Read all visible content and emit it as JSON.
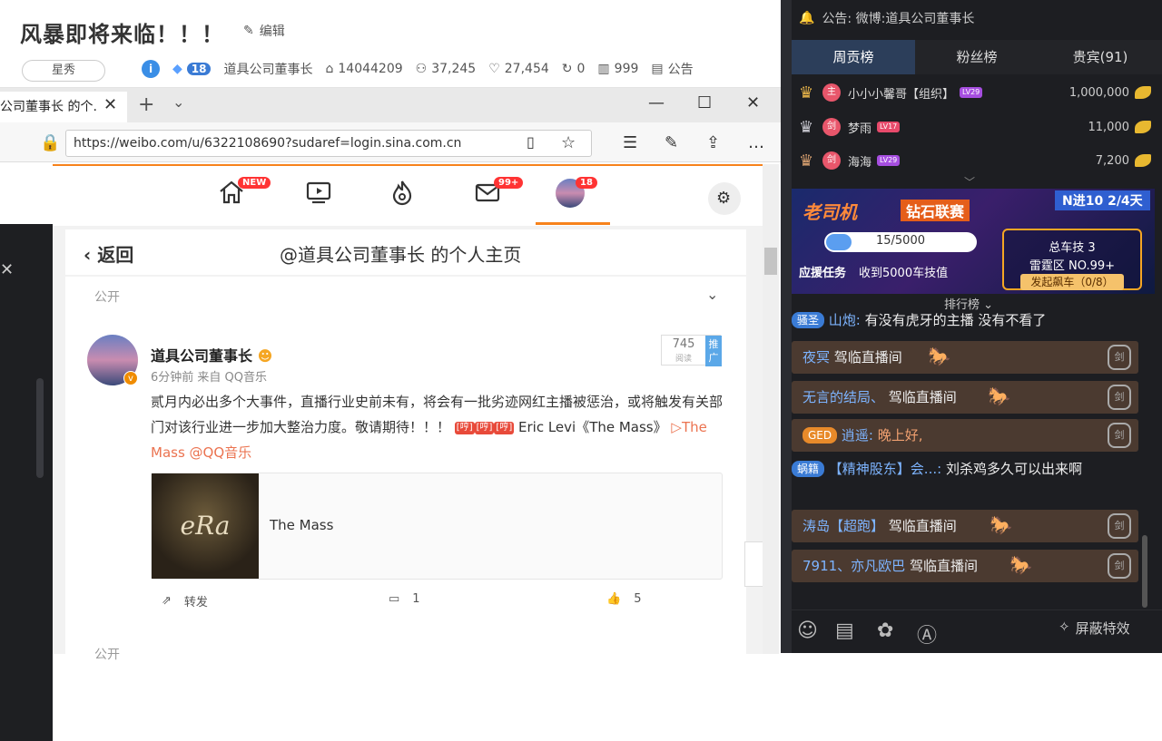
{
  "stream": {
    "title": "风暴即将来临！！！",
    "edit_label": "编辑",
    "star_tag": "星秀",
    "level": "18",
    "streamer": "道具公司董事长",
    "room_id": "14044209",
    "followers": "37,245",
    "likes": "27,454",
    "shares": "0",
    "viewers": "999",
    "notice_label": "公告"
  },
  "browser": {
    "tab_title": "公司董事长 的个.",
    "url": "https://weibo.com/u/6322108690?sudaref=login.sina.com.cn",
    "nav": {
      "home_badge": "NEW",
      "mail_badge": "99+",
      "profile_badge": "18"
    },
    "page_header": {
      "back_label": "返回",
      "title": "@道具公司董事长 的个人主页"
    },
    "feed": {
      "section_label": "公开",
      "post": {
        "author": "道具公司董事长",
        "meta": "6分钟前 来自 QQ音乐",
        "push_count": "745",
        "push_sub": "阅读",
        "push_btn": "推广",
        "text": "贰月内必出多个大事件，直播行业史前未有，将会有一批劣迹网红主播被惩治，或将触发有关部门对该行业进一步加大整治力度。敬请期待！！！",
        "emoji": "[哼]",
        "text_tail": " Eric Levi《The Mass》",
        "music_link": "▷The Mass",
        "music_link2": "@QQ音乐",
        "music_title": "The Mass",
        "cover_text": "eRa",
        "repost_label": "转发",
        "comment_count": "1",
        "like_count": "5"
      },
      "next_section_label": "公开"
    }
  },
  "panel": {
    "notice": "公告: 微博:道具公司董事长",
    "tabs": [
      "周贡榜",
      "粉丝榜",
      "贵宾(91)"
    ],
    "ranks": [
      {
        "badge": "主",
        "name": "小小小馨哥【组织】",
        "lv": "LV29",
        "score": "1,000,000"
      },
      {
        "badge": "剑",
        "name": "梦雨",
        "lv": "LV17",
        "score": "11,000"
      },
      {
        "badge": "剑",
        "name": "海海",
        "lv": "LV29",
        "score": "7,200"
      }
    ],
    "banner": {
      "title": "老司机",
      "sub": "钻石联赛",
      "tag": "N进10 2/4天",
      "progress_text": "15/5000",
      "progress_fraction": 0.003,
      "task_label": "应援任务",
      "task_text": "收到5000车技值",
      "box_line1": "总车技 3",
      "box_line2": "雷霆区 NO.99+",
      "box_btn": "发起飙车（0/8）"
    },
    "rank_button": "排行榜",
    "chat": [
      {
        "badge": "骚圣",
        "user": "山炮:",
        "text": "有没有虎牙的主播 没有不看了",
        "bar": false
      },
      {
        "user": "夜冥",
        "text": "驾临直播间",
        "bar": true
      },
      {
        "user": "无言的结局、",
        "text": "驾临直播间",
        "bar": true
      },
      {
        "badge": "GED",
        "user": "逍遥:",
        "text": "晚上好,",
        "bar": true
      },
      {
        "badge": "蜗籍",
        "user": "【精神股东】会...:",
        "text": "刘杀鸡多久可以出来啊",
        "bar": false
      },
      {
        "user": "涛岛【超跑】",
        "text": "驾临直播间",
        "bar": true
      },
      {
        "user": "7911、亦凡欧巴",
        "text": "驾临直播间",
        "bar": true
      }
    ],
    "hide_effects": "屏蔽特效"
  }
}
